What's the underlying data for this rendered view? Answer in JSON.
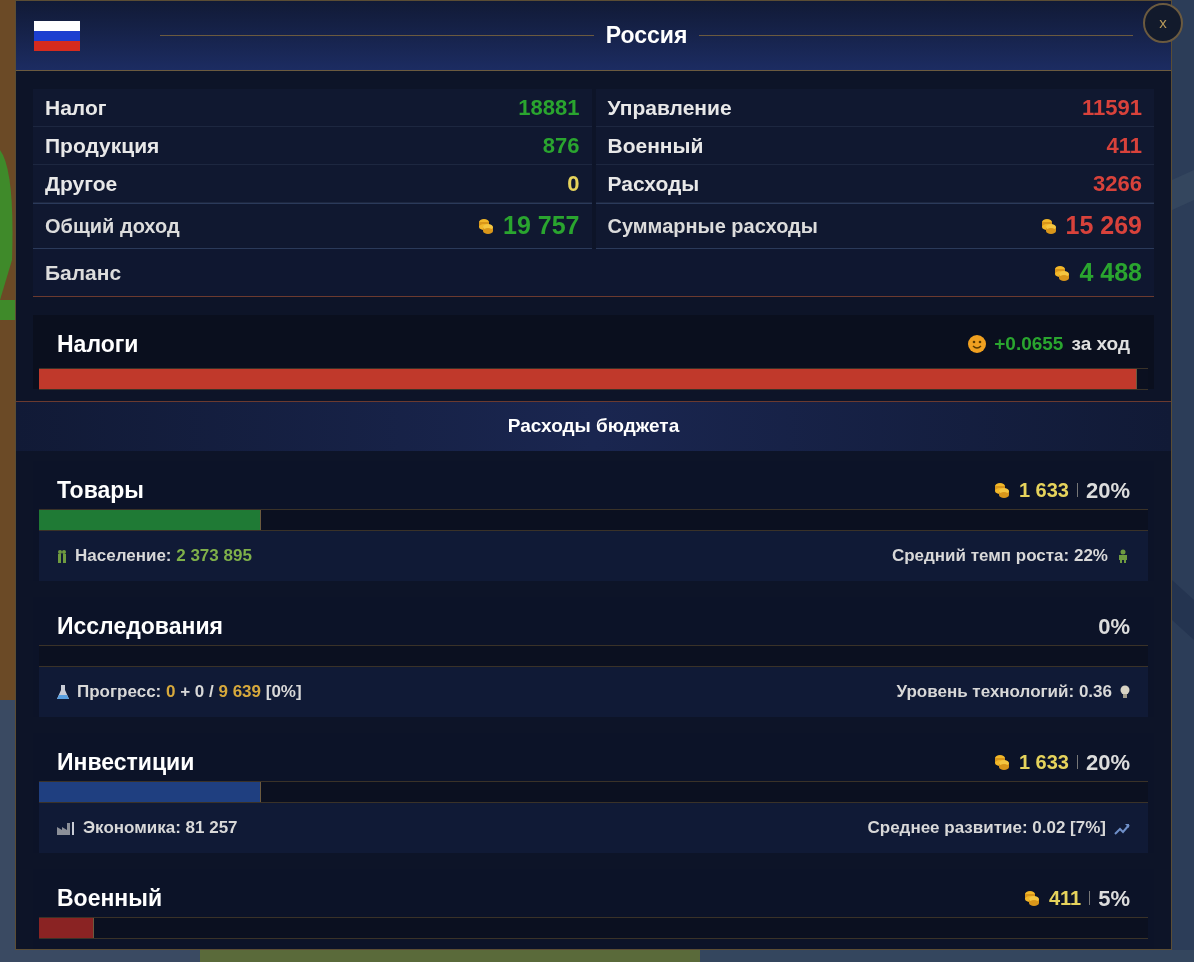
{
  "window": {
    "title": "Россия",
    "close": "x"
  },
  "income": [
    {
      "label": "Налог",
      "value": "18881",
      "color": "#2aa52f"
    },
    {
      "label": "Продукция",
      "value": "876",
      "color": "#2aa52f"
    },
    {
      "label": "Другое",
      "value": "0",
      "color": "#e6d35c"
    }
  ],
  "expenses": [
    {
      "label": "Управление",
      "value": "11591",
      "color": "#d8423b"
    },
    {
      "label": "Военный",
      "value": "411",
      "color": "#d8423b"
    },
    {
      "label": "Расходы",
      "value": "3266",
      "color": "#d8423b"
    }
  ],
  "income_total": {
    "label": "Общий доход",
    "value": "19 757",
    "color": "#2aa52f"
  },
  "expense_total": {
    "label": "Суммарные расходы",
    "value": "15 269",
    "color": "#d8423b"
  },
  "balance": {
    "label": "Баланс",
    "value": "4 488",
    "color": "#2aa52f"
  },
  "taxes": {
    "label": "Налоги",
    "change": "+0.0655",
    "suffix": "за ход",
    "level": 0.99
  },
  "budget": {
    "title": "Расходы бюджета",
    "items": [
      {
        "name": "Товары",
        "amount": "1 633",
        "percent": "20%",
        "level": 0.2,
        "color": "#1f7a35",
        "left": {
          "kind": "people",
          "parts": [
            {
              "text": "Население:",
              "color": "#d8d8d8"
            },
            {
              "text": "2 373 895",
              "color": "#7fb04a"
            }
          ]
        },
        "right": {
          "kind": "person",
          "parts": [
            {
              "text": "Средний темп роста: 22%",
              "color": "#d8d8d8"
            }
          ]
        }
      },
      {
        "name": "Исследования",
        "percent": "0%",
        "left": {
          "kind": "flask",
          "parts": [
            {
              "text": "Прогресс:",
              "color": "#d8d8d8"
            },
            {
              "text": "0",
              "color": "#d7a93c"
            },
            {
              "text": "+ 0 /",
              "color": "#d8d8d8"
            },
            {
              "text": "9 639",
              "color": "#d7a93c"
            },
            {
              "text": "[0%]",
              "color": "#d8d8d8"
            }
          ]
        },
        "right": {
          "kind": "bulb",
          "parts": [
            {
              "text": "Уровень технологий: 0.36",
              "color": "#d8d8d8"
            }
          ]
        }
      },
      {
        "name": "Инвестиции",
        "amount": "1 633",
        "percent": "20%",
        "level": 0.2,
        "color": "#1f3f80",
        "left": {
          "kind": "factory",
          "parts": [
            {
              "text": "Экономика: 81 257",
              "color": "#d8d8d8"
            }
          ]
        },
        "right": {
          "kind": "trend",
          "parts": [
            {
              "text": "Среднее развитие: 0.02 [7%]",
              "color": "#d8d8d8"
            }
          ]
        }
      },
      {
        "name": "Военный",
        "amount": "411",
        "percent": "5%",
        "level": 0.05,
        "color": "#8a2323"
      }
    ]
  }
}
